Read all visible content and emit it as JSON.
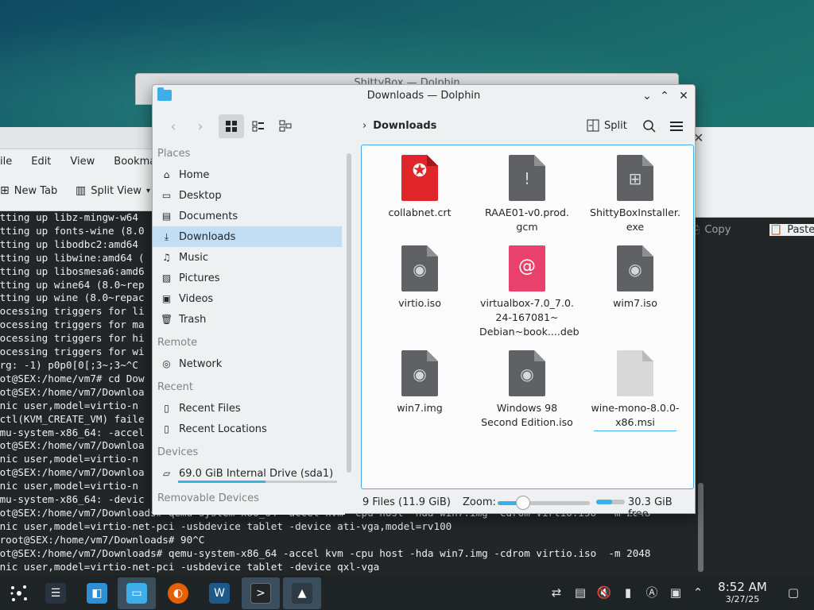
{
  "terminal": {
    "menu": [
      "ile",
      "Edit",
      "View",
      "Bookmarks"
    ],
    "toolbar": {
      "new_tab": "New Tab",
      "split_view": "Split View"
    },
    "lines": [
      "etting up libz-mingw-w64",
      "etting up fonts-wine (8.0",
      "etting up libodbc2:amd64",
      "etting up libwine:amd64 (",
      "etting up libosmesa6:amd6",
      "etting up wine64 (8.0~rep",
      "etting up wine (8.0~repac",
      "rocessing triggers for li",
      "rocessing triggers for ma",
      "rocessing triggers for hi",
      "rocessing triggers for wi",
      "arg: -1) p0p0[0[;3~;3~^C",
      "oot@SEX:/home/vm7# cd Dow",
      "oot@SEX:/home/vm7/Downloa",
      "-nic user,model=virtio-n",
      "octl(KVM_CREATE_VM) faile",
      "emu-system-x86_64: -accel",
      "oot@SEX:/home/vm7/Downloa",
      "-nic user,model=virtio-n",
      "oot@SEX:/home/vm7/Downloa",
      "-nic user,model=virtio-n",
      "emu-system-x86_64: -devic",
      "oot@SEX:/home/vm7/Downloads# qemu-system-x86_64 -accel kvm -cpu host -hda win7.img -cdrom virtio.iso  -m 2048",
      "-nic user,model=virtio-net-pci -usbdevice tablet -device ati-vga,model=rv100",
      "uroot@SEX:/home/vm7/Downloads# 90^C",
      "oot@SEX:/home/vm7/Downloads# qemu-system-x86_64 -accel kvm -cpu host -hda win7.img -cdrom virtio.iso  -m 2048",
      "-nic user,model=virtio-net-pci -usbdevice tablet -device qxl-vga"
    ]
  },
  "back_right": {
    "copy": "Copy",
    "paste": "Paste"
  },
  "back_dolphin": {
    "title": "ShittyBox — Dolphin"
  },
  "dolphin": {
    "title": "Downloads — Dolphin",
    "breadcrumb": "Downloads",
    "split_label": "Split",
    "places": {
      "places_header": "Places",
      "items": [
        "Home",
        "Desktop",
        "Documents",
        "Downloads",
        "Music",
        "Pictures",
        "Videos",
        "Trash"
      ],
      "remote_header": "Remote",
      "remote_items": [
        "Network"
      ],
      "recent_header": "Recent",
      "recent_items": [
        "Recent Files",
        "Recent Locations"
      ],
      "devices_header": "Devices",
      "device": "69.0 GiB Internal Drive (sda1)",
      "device_usage": 0.55,
      "removable_header": "Removable Devices"
    },
    "files": [
      {
        "name": "collabnet.crt",
        "icon": "certificate-icon"
      },
      {
        "name": "RAAE01-v0.prod.\ngcm",
        "icon": "warning-file-icon"
      },
      {
        "name": "ShittyBoxInstaller.\nexe",
        "icon": "executable-icon"
      },
      {
        "name": "virtio.iso",
        "icon": "disc-image-icon"
      },
      {
        "name": "virtualbox-7.0_7.0.\n24-167081~\nDebian~book....deb",
        "icon": "debian-package-icon"
      },
      {
        "name": "wim7.iso",
        "icon": "disc-image-icon"
      },
      {
        "name": "win7.img",
        "icon": "disc-image-icon"
      },
      {
        "name": "Windows 98\nSecond Edition.iso",
        "icon": "disc-image-icon"
      },
      {
        "name": "wine-mono-8.0.0-\nx86.msi",
        "icon": "installer-icon"
      }
    ],
    "status": {
      "count": "9 Files (11.9 GiB)",
      "zoom_label": "Zoom:",
      "zoom_level": 0.28,
      "free": "30.3 GiB free",
      "free_fraction": 0.55
    }
  },
  "taskbar": {
    "time": "8:52 AM",
    "date": "3/27/25"
  },
  "colors": {
    "accent": "#3daee9",
    "selection": "#c2def4",
    "taskbar": "#1e2326"
  }
}
